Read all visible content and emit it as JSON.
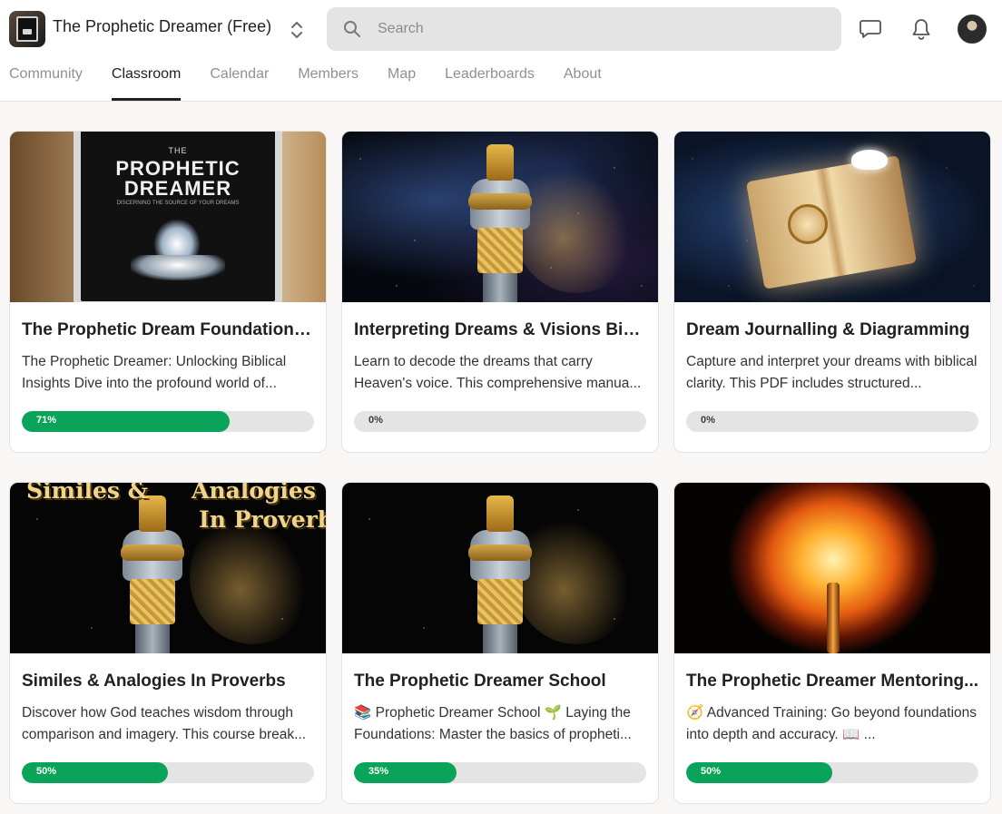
{
  "header": {
    "group_name": "The Prophetic Dreamer (Free)",
    "search_placeholder": "Search",
    "icons": [
      "chat-icon",
      "bell-icon"
    ]
  },
  "tabs": [
    {
      "label": "Community",
      "active": false
    },
    {
      "label": "Classroom",
      "active": true
    },
    {
      "label": "Calendar",
      "active": false
    },
    {
      "label": "Members",
      "active": false
    },
    {
      "label": "Map",
      "active": false
    },
    {
      "label": "Leaderboards",
      "active": false
    },
    {
      "label": "About",
      "active": false
    }
  ],
  "theme": {
    "progress_color": "#0aa35a",
    "progress_track": "#e4e4e4",
    "search_bg": "#e4e4e4"
  },
  "courses": [
    {
      "title": "The Prophetic Dream Foundations...",
      "description": "The Prophetic Dreamer: Unlocking Biblical Insights Dive into the profound world of...",
      "progress": 71,
      "progress_label": "71%",
      "thumb": {
        "line1": "THE",
        "line2": "PROPHETIC",
        "line3": "DREAMER",
        "line4": "DISCERNING THE SOURCE OF YOUR DREAMS"
      }
    },
    {
      "title": "Interpreting Dreams & Visions Bib...",
      "description": "Learn to decode the dreams that carry Heaven's voice. This comprehensive manua...",
      "progress": 0,
      "progress_label": "0%"
    },
    {
      "title": "Dream Journalling & Diagramming",
      "description": "Capture and interpret your dreams with biblical clarity. This PDF includes structured...",
      "progress": 0,
      "progress_label": "0%"
    },
    {
      "title": "Similes & Analogies In Proverbs",
      "description": "Discover how God teaches wisdom through comparison and imagery. This course break...",
      "progress": 50,
      "progress_label": "50%",
      "thumb": {
        "line1": "Similes &",
        "line2": "Analogies",
        "line3": "In Proverbs"
      }
    },
    {
      "title": "The Prophetic Dreamer School",
      "description": "📚 Prophetic Dreamer School 🌱 Laying the Foundations: Master the basics of propheti...",
      "progress": 35,
      "progress_label": "35%"
    },
    {
      "title": "The Prophetic Dreamer Mentoring...",
      "description": "🧭 Advanced Training: Go beyond foundations into depth and accuracy. 📖 ...",
      "progress": 50,
      "progress_label": "50%"
    }
  ]
}
